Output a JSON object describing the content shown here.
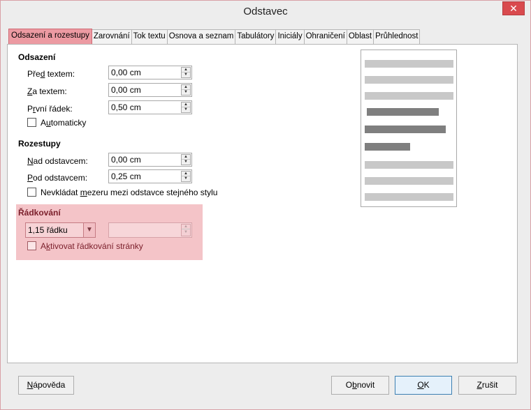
{
  "window": {
    "title": "Odstavec",
    "close_glyph": "✕"
  },
  "tabs": [
    {
      "label": "Odsazení a rozestupy",
      "active": true
    },
    {
      "label": "Zarovnání"
    },
    {
      "label": "Tok textu"
    },
    {
      "label": "Osnova a seznam"
    },
    {
      "label": "Tabulátory"
    },
    {
      "label": "Iniciály"
    },
    {
      "label": "Ohraničení"
    },
    {
      "label": "Oblast"
    },
    {
      "label": "Průhlednost"
    }
  ],
  "indent": {
    "title": "Odsazení",
    "before_label": {
      "pre": "Pře",
      "u": "d",
      "post": " textem:"
    },
    "before_value": "0,00 cm",
    "after_label": {
      "pre": "",
      "u": "Z",
      "post": "a textem:"
    },
    "after_value": "0,00 cm",
    "first_label": {
      "pre": "P",
      "u": "r",
      "post": "vní řádek:"
    },
    "first_value": "0,50 cm",
    "auto_label": {
      "pre": "A",
      "u": "u",
      "post": "tomaticky"
    }
  },
  "spacing": {
    "title": "Rozestupy",
    "above_label": {
      "pre": "",
      "u": "N",
      "post": "ad odstavcem:"
    },
    "above_value": "0,00 cm",
    "below_label": {
      "pre": "",
      "u": "P",
      "post": "od odstavcem:"
    },
    "below_value": "0,25 cm",
    "noadd_label": {
      "pre": "Nevkládat ",
      "u": "m",
      "post": "ezeru mezi odstavce stejného stylu"
    }
  },
  "line_spacing": {
    "title": "Řádkování",
    "selected": "1,15 řádku",
    "value": "",
    "register_label": {
      "pre": "A",
      "u": "k",
      "post": "tivovat řádkování stránky"
    }
  },
  "buttons": {
    "help": {
      "pre": "",
      "u": "N",
      "post": "ápověda"
    },
    "reset": {
      "pre": "O",
      "u": "b",
      "post": "novit"
    },
    "ok": {
      "pre": "",
      "u": "O",
      "post": "K"
    },
    "cancel": {
      "pre": "",
      "u": "Z",
      "post": "rušit"
    }
  },
  "colors": {
    "accent": "#ec9aa2",
    "highlight": "#f4c4c8",
    "close": "#d94a4e"
  }
}
